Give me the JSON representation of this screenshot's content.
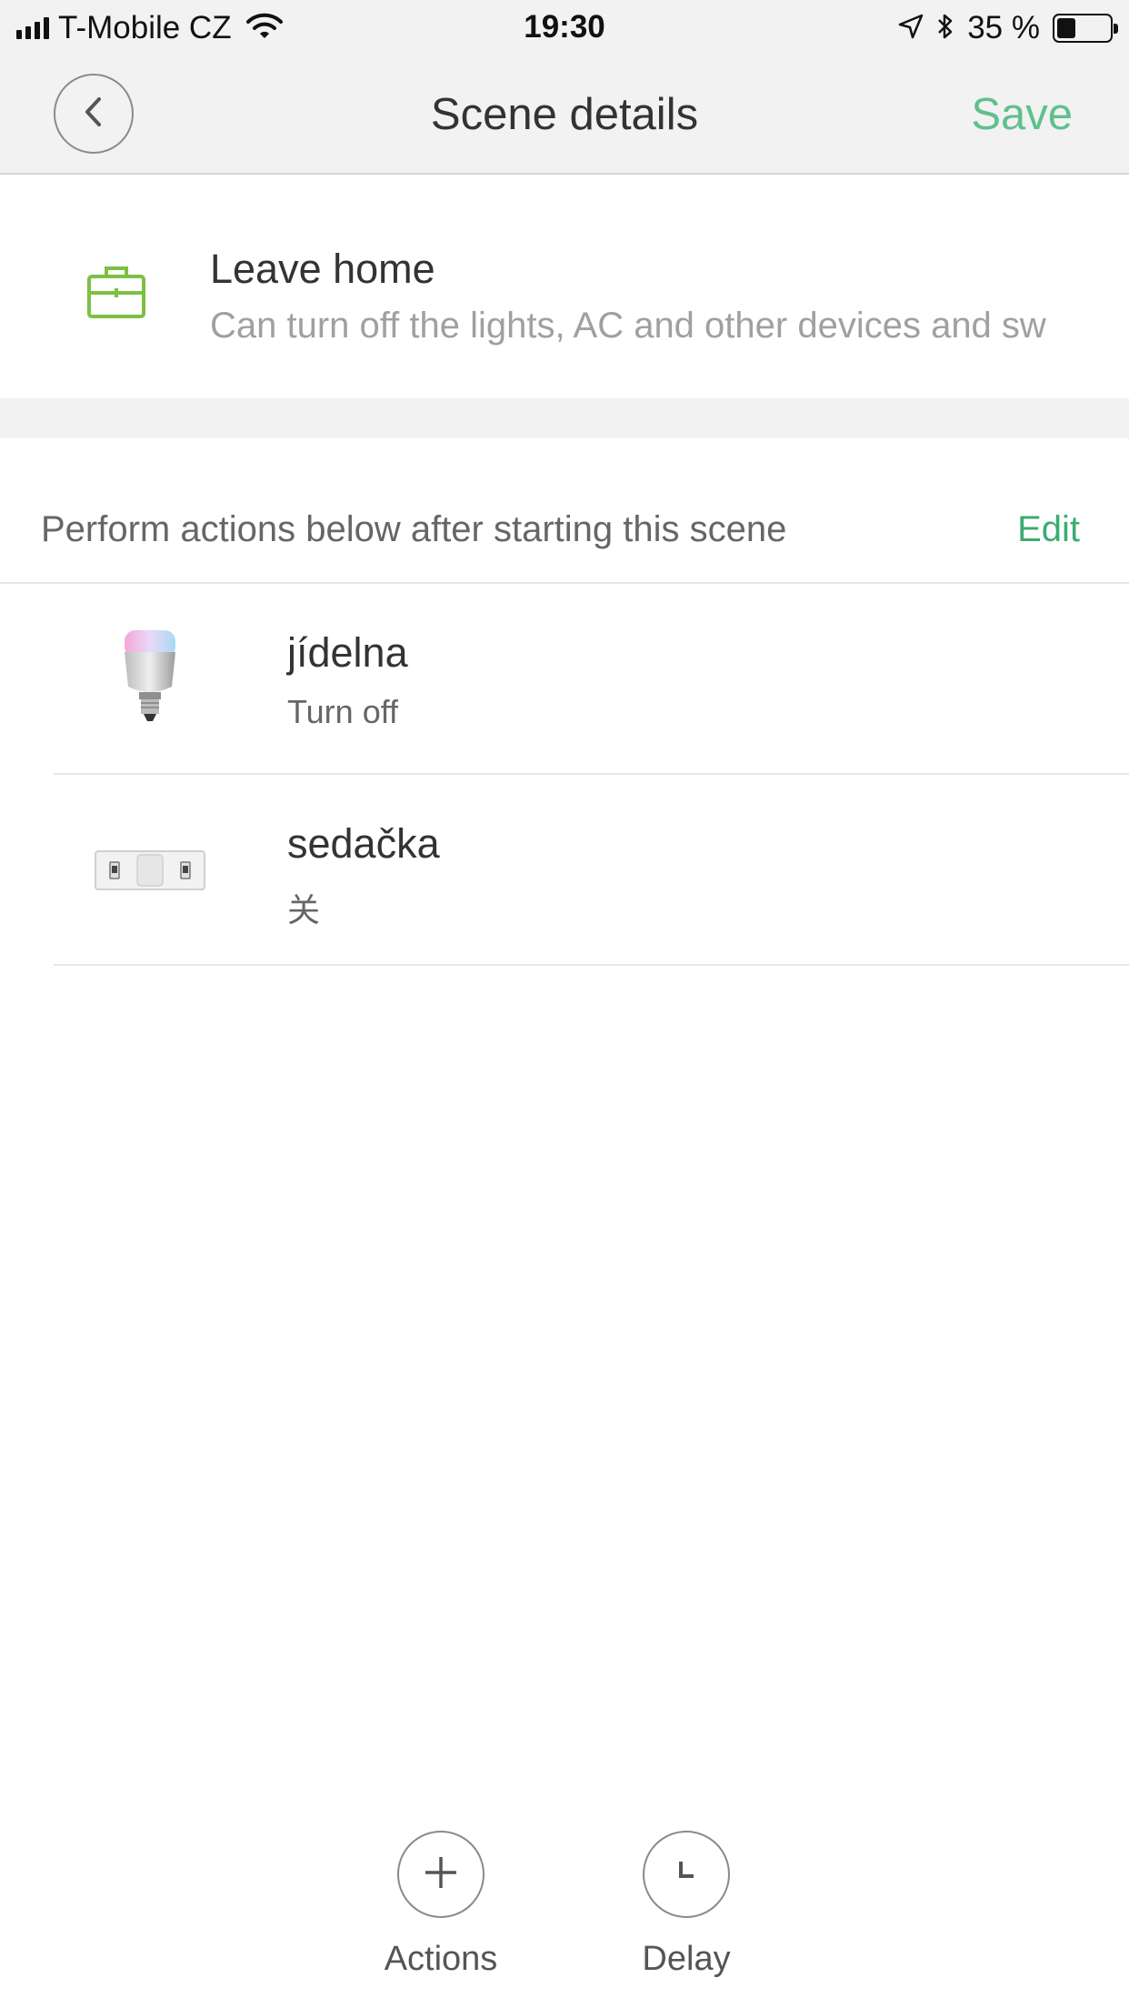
{
  "status_bar": {
    "carrier": "T-Mobile CZ",
    "time": "19:30",
    "battery_percent": "35 %",
    "battery_level": 0.35,
    "icons": [
      "signal-icon",
      "wifi-icon",
      "location-icon",
      "bluetooth-icon",
      "battery-icon"
    ]
  },
  "nav": {
    "title": "Scene details",
    "save_label": "Save",
    "back_icon": "chevron-left-icon"
  },
  "scene": {
    "icon": "briefcase-icon",
    "name": "Leave home",
    "description": "Can turn off the lights, AC and other devices and sw"
  },
  "actions_section": {
    "label": "Perform actions below after starting this scene",
    "edit_label": "Edit",
    "items": [
      {
        "name": "jídelna",
        "status": "Turn off",
        "thumb": "light-bulb-image"
      },
      {
        "name": "sedačka",
        "status": "关",
        "thumb": "light-strip-image"
      }
    ]
  },
  "bottom_buttons": {
    "actions_label": "Actions",
    "actions_icon": "plus-icon",
    "delay_label": "Delay",
    "delay_icon": "clock-icon"
  },
  "colors": {
    "accent_green": "#5fc08d",
    "edit_green": "#3cab72",
    "scene_icon_green": "#7cc142",
    "bar_background": "#f2f2f2"
  }
}
